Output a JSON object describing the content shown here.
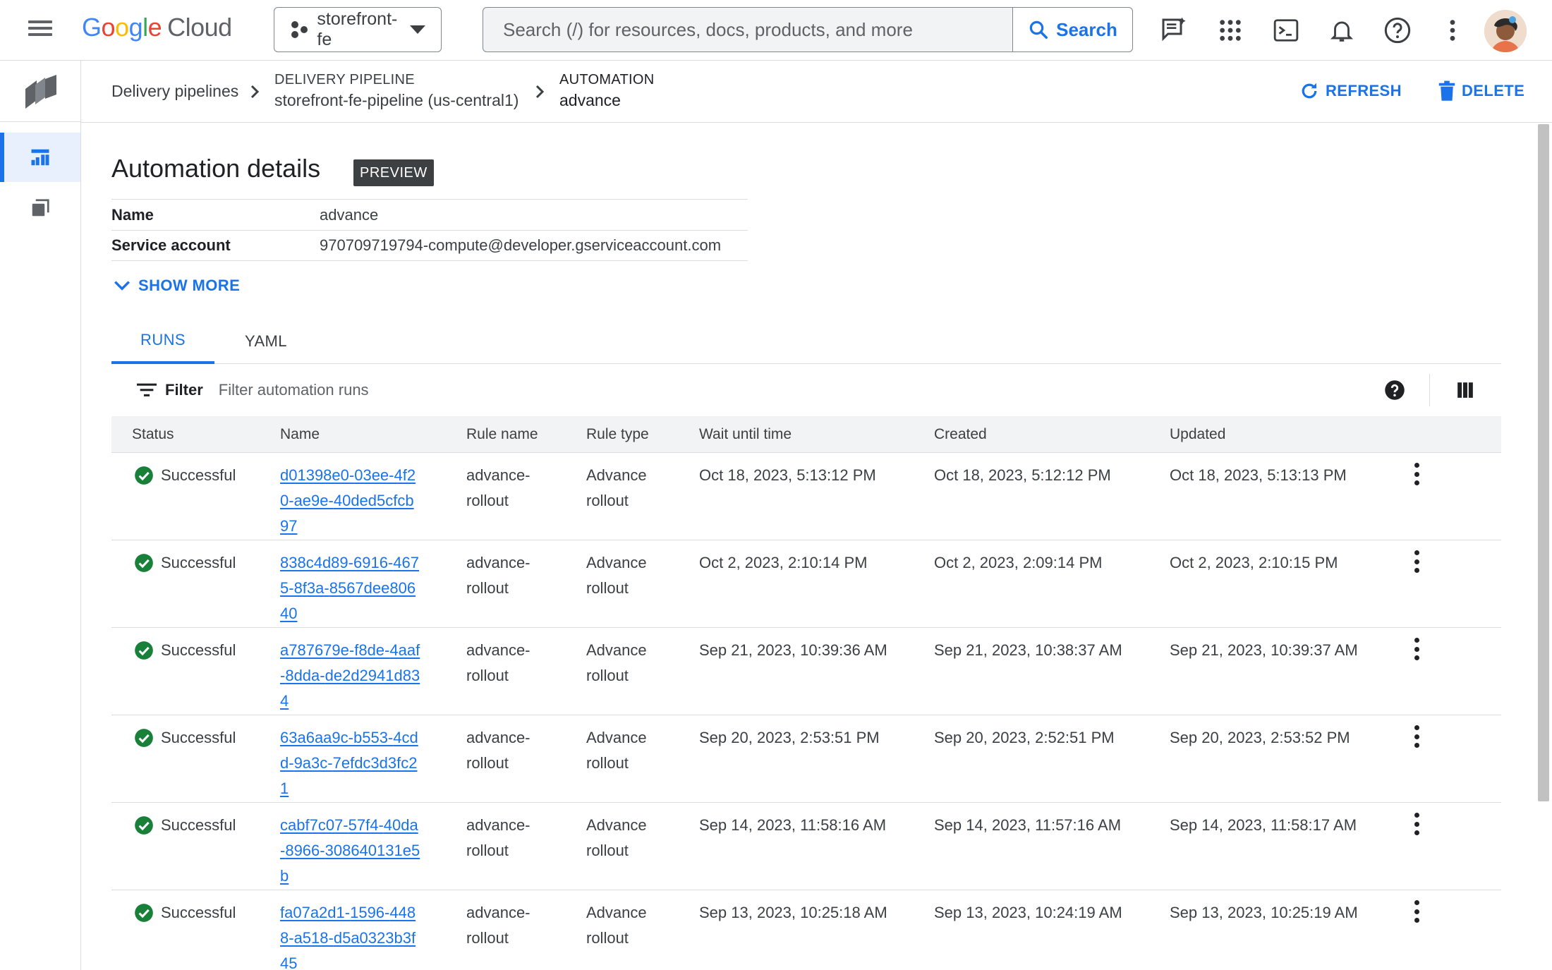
{
  "topbar": {
    "logo_google": [
      "G",
      "o",
      "o",
      "g",
      "l",
      "e"
    ],
    "logo_cloud": "Cloud",
    "project": "storefront-fe",
    "search_placeholder": "Search (/) for resources, docs, products, and more",
    "search_button": "Search",
    "icons": [
      "menu-icon",
      "gemini-chat-icon",
      "apps-grid-icon",
      "cloud-shell-icon",
      "notifications-bell-icon",
      "help-icon",
      "more-vert-icon"
    ]
  },
  "rail": {
    "items": [
      "deploy-product-icon",
      "delivery-pipelines-icon",
      "targets-icon"
    ]
  },
  "breadcrumb": {
    "root": "Delivery pipelines",
    "pipeline_kind": "DELIVERY PIPELINE",
    "pipeline_value": "storefront-fe-pipeline (us-central1)",
    "automation_kind": "AUTOMATION",
    "automation_value": "advance"
  },
  "actions": {
    "refresh": "REFRESH",
    "delete": "DELETE"
  },
  "details": {
    "title": "Automation details",
    "badge": "PREVIEW",
    "rows": [
      {
        "key": "Name",
        "value": "advance"
      },
      {
        "key": "Service account",
        "value": "970709719794-compute@developer.gserviceaccount.com"
      }
    ],
    "show_more": "SHOW MORE"
  },
  "tabs": [
    "RUNS",
    "YAML"
  ],
  "filter": {
    "label": "Filter",
    "placeholder": "Filter automation runs"
  },
  "table": {
    "columns": [
      "Status",
      "Name",
      "Rule name",
      "Rule type",
      "Wait until time",
      "Created",
      "Updated"
    ],
    "rows": [
      {
        "status": "Successful",
        "name": "d01398e0-03ee-4f20-ae9e-40ded5cfcb97",
        "rule_name": "advance-rollout",
        "rule_type": "Advance rollout",
        "wait": "Oct 18, 2023, 5:13:12 PM",
        "created": "Oct 18, 2023, 5:12:12 PM",
        "updated": "Oct 18, 2023, 5:13:13 PM"
      },
      {
        "status": "Successful",
        "name": "838c4d89-6916-4675-8f3a-8567dee80640",
        "rule_name": "advance-rollout",
        "rule_type": "Advance rollout",
        "wait": "Oct 2, 2023, 2:10:14 PM",
        "created": "Oct 2, 2023, 2:09:14 PM",
        "updated": "Oct 2, 2023, 2:10:15 PM"
      },
      {
        "status": "Successful",
        "name": "a787679e-f8de-4aaf-8dda-de2d2941d834",
        "rule_name": "advance-rollout",
        "rule_type": "Advance rollout",
        "wait": "Sep 21, 2023, 10:39:36 AM",
        "created": "Sep 21, 2023, 10:38:37 AM",
        "updated": "Sep 21, 2023, 10:39:37 AM"
      },
      {
        "status": "Successful",
        "name": "63a6aa9c-b553-4cdd-9a3c-7efdc3d3fc21",
        "rule_name": "advance-rollout",
        "rule_type": "Advance rollout",
        "wait": "Sep 20, 2023, 2:53:51 PM",
        "created": "Sep 20, 2023, 2:52:51 PM",
        "updated": "Sep 20, 2023, 2:53:52 PM"
      },
      {
        "status": "Successful",
        "name": "cabf7c07-57f4-40da-8966-308640131e5b",
        "rule_name": "advance-rollout",
        "rule_type": "Advance rollout",
        "wait": "Sep 14, 2023, 11:58:16 AM",
        "created": "Sep 14, 2023, 11:57:16 AM",
        "updated": "Sep 14, 2023, 11:58:17 AM"
      },
      {
        "status": "Successful",
        "name": "fa07a2d1-1596-4488-a518-d5a0323b3f45",
        "rule_name": "advance-rollout",
        "rule_type": "Advance rollout",
        "wait": "Sep 13, 2023, 10:25:18 AM",
        "created": "Sep 13, 2023, 10:24:19 AM",
        "updated": "Sep 13, 2023, 10:25:19 AM"
      }
    ]
  },
  "colors": {
    "accent": "#1a73e8",
    "success": "#188038",
    "badge_bg": "#3c4043"
  }
}
